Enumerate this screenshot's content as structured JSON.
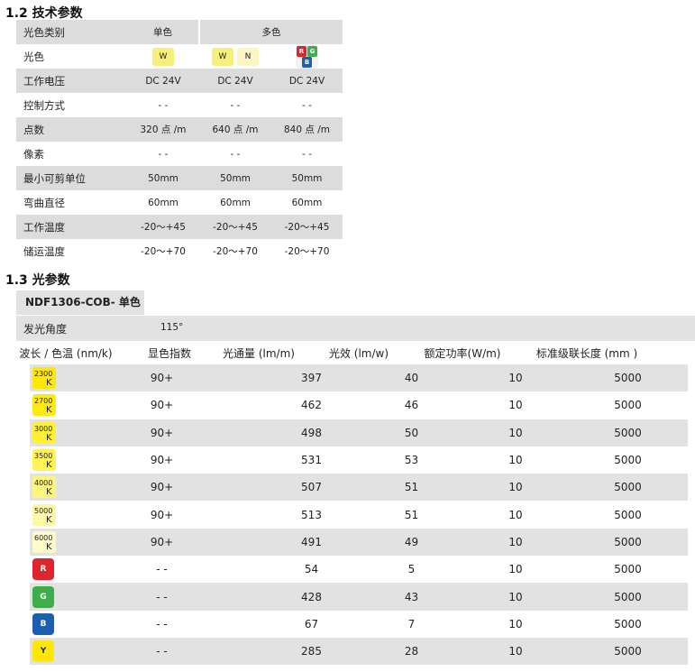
{
  "section_1_2": {
    "heading": "1.2 技术参数",
    "rows": [
      {
        "label": "光色类别",
        "mono": "单色",
        "multi": "多色"
      },
      {
        "label": "光色",
        "mono": "W",
        "multi_chips": [
          "W",
          "N"
        ],
        "rgb": [
          "R",
          "G",
          "B"
        ]
      },
      {
        "label": "工作电压",
        "values": [
          "DC 24V",
          "DC 24V",
          "DC 24V"
        ]
      },
      {
        "label": "控制方式",
        "values": [
          "- -",
          "- -",
          "- -"
        ]
      },
      {
        "label": "点数",
        "values": [
          "320 点 /m",
          "640 点 /m",
          "840 点 /m"
        ]
      },
      {
        "label": "像素",
        "values": [
          "- -",
          "- -",
          "- -"
        ]
      },
      {
        "label": "最小可剪单位",
        "values": [
          "50mm",
          "50mm",
          "50mm"
        ]
      },
      {
        "label": "弯曲直径",
        "values": [
          "60mm",
          "60mm",
          "60mm"
        ]
      },
      {
        "label": "工作温度",
        "values": [
          "-20～+45",
          "-20～+45",
          "-20～+45"
        ]
      },
      {
        "label": "储运温度",
        "values": [
          "-20～+70",
          "-20～+70",
          "-20～+70"
        ]
      }
    ]
  },
  "section_1_3": {
    "heading": "1.3 光参数",
    "tab": "NDF1306-COB- 单色",
    "angle_label": "发光角度",
    "angle_value": "115°",
    "headers": [
      "波长 / 色温 (nm/k)",
      "显色指数",
      "光通量 (lm/m)",
      "光效 (lm/w)",
      "额定功率(W/m)",
      "标准级联长度 (mm )"
    ],
    "rows": [
      {
        "type": "cct",
        "cct": "2300",
        "unit": "K",
        "color": "#ffe800",
        "cri": "90+",
        "flux": "397",
        "efficacy": "40",
        "power": "10",
        "length": "5000"
      },
      {
        "type": "cct",
        "cct": "2700",
        "unit": "K",
        "color": "#ffea10",
        "cri": "90+",
        "flux": "462",
        "efficacy": "46",
        "power": "10",
        "length": "5000"
      },
      {
        "type": "cct",
        "cct": "3000",
        "unit": "K",
        "color": "#fff033",
        "cri": "90+",
        "flux": "498",
        "efficacy": "50",
        "power": "10",
        "length": "5000"
      },
      {
        "type": "cct",
        "cct": "3500",
        "unit": "K",
        "color": "#fff357",
        "cri": "90+",
        "flux": "531",
        "efficacy": "53",
        "power": "10",
        "length": "5000"
      },
      {
        "type": "cct",
        "cct": "4000",
        "unit": "K",
        "color": "#fff57d",
        "cri": "90+",
        "flux": "507",
        "efficacy": "51",
        "power": "10",
        "length": "5000"
      },
      {
        "type": "cct",
        "cct": "5000",
        "unit": "K",
        "color": "#fff8a6",
        "cri": "90+",
        "flux": "513",
        "efficacy": "51",
        "power": "10",
        "length": "5000"
      },
      {
        "type": "cct",
        "cct": "6000",
        "unit": "K",
        "color": "#fffbc9",
        "cri": "90+",
        "flux": "491",
        "efficacy": "49",
        "power": "10",
        "length": "5000"
      },
      {
        "type": "color",
        "label": "R",
        "color": "#e0242b",
        "cri": "- -",
        "flux": "54",
        "efficacy": "5",
        "power": "10",
        "length": "5000"
      },
      {
        "type": "color",
        "label": "G",
        "color": "#3dae49",
        "cri": "- -",
        "flux": "428",
        "efficacy": "43",
        "power": "10",
        "length": "5000"
      },
      {
        "type": "color",
        "label": "B",
        "color": "#1c5fae",
        "cri": "- -",
        "flux": "67",
        "efficacy": "7",
        "power": "10",
        "length": "5000"
      },
      {
        "type": "color",
        "label": "Y",
        "color": "#ffe800",
        "text_color": "#222222",
        "cri": "- -",
        "flux": "285",
        "efficacy": "28",
        "power": "10",
        "length": "5000"
      }
    ]
  }
}
